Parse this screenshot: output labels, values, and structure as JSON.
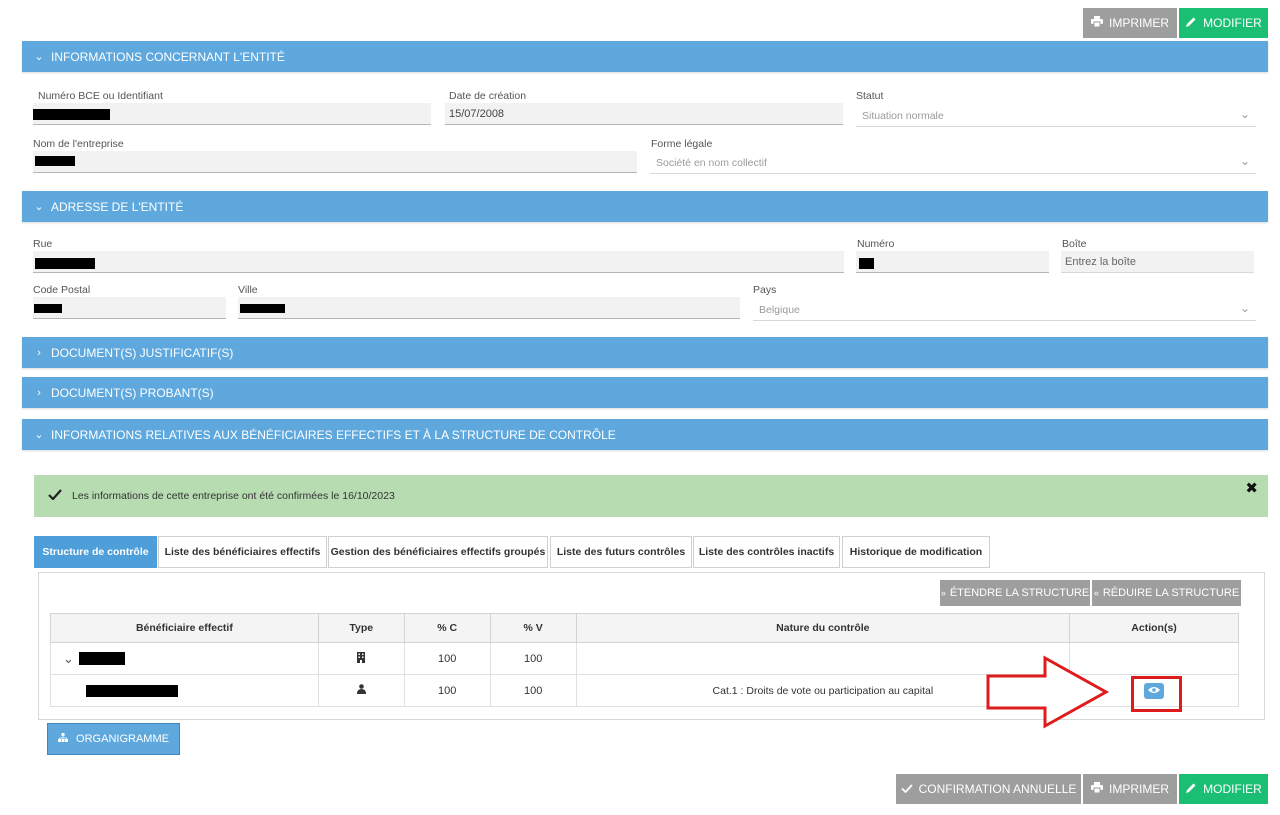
{
  "toolbar_top": {
    "print_label": "IMPRIMER",
    "edit_label": "MODIFIER"
  },
  "sections": {
    "entity_info": "INFORMATIONS CONCERNANT L'ENTITÉ",
    "entity_address": "ADRESSE DE L'ENTITÉ",
    "supporting_docs": "DOCUMENT(S) JUSTIFICATIF(S)",
    "probative_docs": "DOCUMENT(S) PROBANT(S)",
    "beneficiaries": "INFORMATIONS RELATIVES AUX BÉNÉFICIAIRES EFFECTIFS ET À LA STRUCTURE DE CONTRÔLE"
  },
  "entity": {
    "bce_label": "Numéro BCE ou Identifiant",
    "creation_date_label": "Date de création",
    "creation_date": "15/07/2008",
    "status_label": "Statut",
    "status_value": "Situation normale",
    "company_name_label": "Nom de l'entreprise",
    "legal_form_label": "Forme légale",
    "legal_form_value": "Société en nom collectif"
  },
  "address": {
    "street_label": "Rue",
    "number_label": "Numéro",
    "box_label": "Boîte",
    "box_placeholder": "Entrez la boîte",
    "postal_label": "Code Postal",
    "city_label": "Ville",
    "country_label": "Pays",
    "country_value": "Belgique"
  },
  "alert": {
    "message": "Les informations de cette entreprise ont été confirmées le 16/10/2023"
  },
  "tabs": [
    {
      "label": "Structure de contrôle"
    },
    {
      "label": "Liste des bénéficiaires effectifs"
    },
    {
      "label": "Gestion des bénéficiaires effectifs groupés"
    },
    {
      "label": "Liste des futurs contrôles"
    },
    {
      "label": "Liste des contrôles inactifs"
    },
    {
      "label": "Historique de modification"
    }
  ],
  "structure": {
    "expand_label": "ÉTENDRE LA STRUCTURE",
    "collapse_label": "RÉDUIRE LA STRUCTURE",
    "columns": [
      "Bénéficiaire effectif",
      "Type",
      "% C",
      "% V",
      "Nature du contrôle",
      "Action(s)"
    ],
    "rows": [
      {
        "type_icon": "building-icon",
        "pct_c": "100",
        "pct_v": "100",
        "nature": ""
      },
      {
        "type_icon": "person-icon",
        "pct_c": "100",
        "pct_v": "100",
        "nature": "Cat.1 : Droits de vote ou participation au capital",
        "action_icon": "eye-icon"
      }
    ]
  },
  "org_chart_label": "ORGANIGRAMME",
  "toolbar_bottom": {
    "confirm_label": "CONFIRMATION ANNUELLE",
    "print_label": "IMPRIMER",
    "edit_label": "MODIFIER"
  },
  "colors": {
    "section_blue": "#5ea8de",
    "success_green": "#1bbf73",
    "alert_bg": "#b7dcb1",
    "highlight_red": "#e01b1b"
  }
}
